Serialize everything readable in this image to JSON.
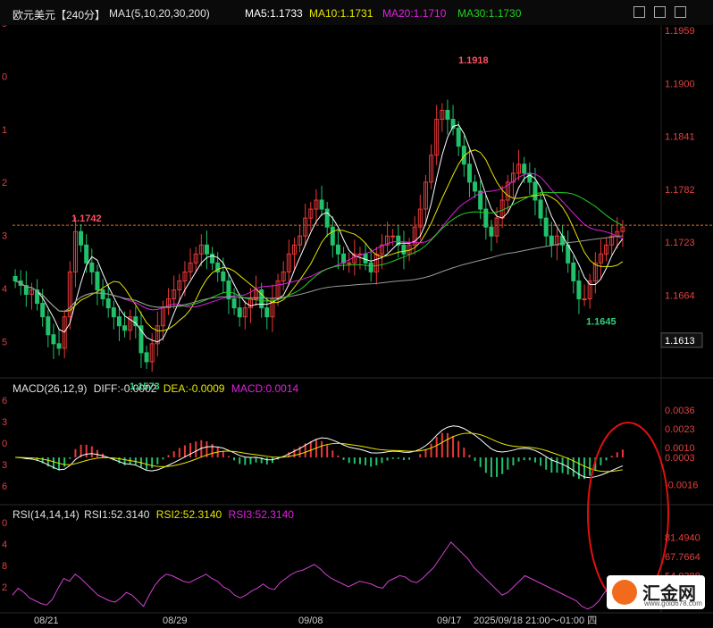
{
  "header": {
    "title": "欧元美元【240分】",
    "ma_label": "MA1(5,10,20,30,200)",
    "ma5": "MA5:1.1733",
    "ma10": "MA10:1.1731",
    "ma20": "MA20:1.1710",
    "ma30": "MA30:1.1730",
    "colors": {
      "ma5": "#ffffff",
      "ma10": "#e6e600",
      "ma20": "#e020e0",
      "ma30": "#20d020",
      "ma200": "#9a9a9a"
    }
  },
  "macd_panel": {
    "label": "MACD(26,12,9)",
    "diff": "DIFF:-0.0002",
    "dea": "DEA:-0.0009",
    "macd": "MACD:0.0014"
  },
  "rsi_panel": {
    "label": "RSI(14,14,14)",
    "rsi1": "RSI1:52.3140",
    "rsi2": "RSI2:52.3140",
    "rsi3": "RSI3:52.3140"
  },
  "watermark": {
    "name": "汇金网",
    "url": "www.gold678.com"
  },
  "chart_data": [
    {
      "type": "candlestick",
      "y_ticks": [
        "1.1959",
        "1.1900",
        "1.1841",
        "1.1782",
        "1.1723",
        "1.1664",
        "1.1613"
      ],
      "current_price": "1.1613",
      "ylim": [
        1.1575,
        1.1965
      ],
      "annotations": [
        {
          "text": "1.1918",
          "value": 1.1918
        },
        {
          "text": "1.1742",
          "value": 1.1742
        },
        {
          "text": "1.1645",
          "value": 1.1645
        },
        {
          "text": "1.1573",
          "value": 1.1573
        }
      ],
      "reference_line": 1.1742,
      "x_ticks": [
        "08/21",
        "08/29",
        "09/08",
        "09/17",
        "2025/09/18 21:00～01:00 四"
      ],
      "left_tick_fragments": [
        "9",
        "0",
        "1",
        "2",
        "3",
        "4",
        "5"
      ],
      "close_series": [
        1.168,
        1.1675,
        1.1665,
        1.167,
        1.1655,
        1.164,
        1.162,
        1.161,
        1.1605,
        1.164,
        1.169,
        1.1735,
        1.172,
        1.17,
        1.169,
        1.167,
        1.166,
        1.165,
        1.164,
        1.163,
        1.1625,
        1.164,
        1.163,
        1.16,
        1.159,
        1.161,
        1.163,
        1.165,
        1.166,
        1.167,
        1.168,
        1.169,
        1.17,
        1.171,
        1.172,
        1.171,
        1.17,
        1.169,
        1.168,
        1.166,
        1.165,
        1.164,
        1.165,
        1.166,
        1.167,
        1.165,
        1.164,
        1.166,
        1.168,
        1.169,
        1.171,
        1.172,
        1.173,
        1.175,
        1.176,
        1.177,
        1.176,
        1.174,
        1.172,
        1.171,
        1.17,
        1.17,
        1.171,
        1.171,
        1.17,
        1.169,
        1.171,
        1.172,
        1.173,
        1.173,
        1.172,
        1.171,
        1.172,
        1.174,
        1.176,
        1.179,
        1.182,
        1.186,
        1.187,
        1.186,
        1.185,
        1.183,
        1.181,
        1.179,
        1.178,
        1.176,
        1.174,
        1.173,
        1.175,
        1.177,
        1.179,
        1.18,
        1.181,
        1.18,
        1.179,
        1.177,
        1.175,
        1.173,
        1.172,
        1.173,
        1.172,
        1.17,
        1.168,
        1.166,
        1.166,
        1.168,
        1.17,
        1.171,
        1.172,
        1.173,
        1.1735,
        1.174
      ]
    },
    {
      "type": "macd",
      "y_ticks": [
        "0.0036",
        "0.0023",
        "0.0010",
        "0.0003",
        "-0.0016"
      ],
      "ylim": [
        -0.0028,
        0.0044
      ],
      "left_tick_fragments": [
        "6",
        "3",
        "0",
        "3",
        "6"
      ]
    },
    {
      "type": "rsi",
      "y_ticks": [
        "81.4940",
        "67.7664",
        "54.0388",
        "40.3112"
      ],
      "ylim": [
        28,
        92
      ],
      "left_tick_fragments": [
        "0",
        "4",
        "8",
        "2"
      ],
      "values": [
        40,
        45,
        42,
        38,
        36,
        34,
        33,
        37,
        45,
        52,
        50,
        55,
        52,
        48,
        44,
        40,
        38,
        36,
        35,
        38,
        42,
        40,
        36,
        32,
        40,
        47,
        52,
        55,
        54,
        52,
        50,
        49,
        51,
        53,
        55,
        52,
        50,
        46,
        44,
        40,
        38,
        40,
        43,
        45,
        48,
        45,
        44,
        49,
        52,
        55,
        57,
        58,
        60,
        62,
        59,
        55,
        52,
        50,
        48,
        46,
        48,
        50,
        49,
        48,
        46,
        45,
        50,
        52,
        54,
        53,
        50,
        49,
        52,
        56,
        60,
        66,
        72,
        78,
        74,
        70,
        66,
        60,
        56,
        52,
        48,
        44,
        40,
        42,
        46,
        50,
        54,
        52,
        50,
        48,
        46,
        44,
        42,
        40,
        38,
        36,
        32,
        30,
        32,
        36,
        42,
        46,
        50,
        52,
        54,
        52
      ]
    }
  ]
}
